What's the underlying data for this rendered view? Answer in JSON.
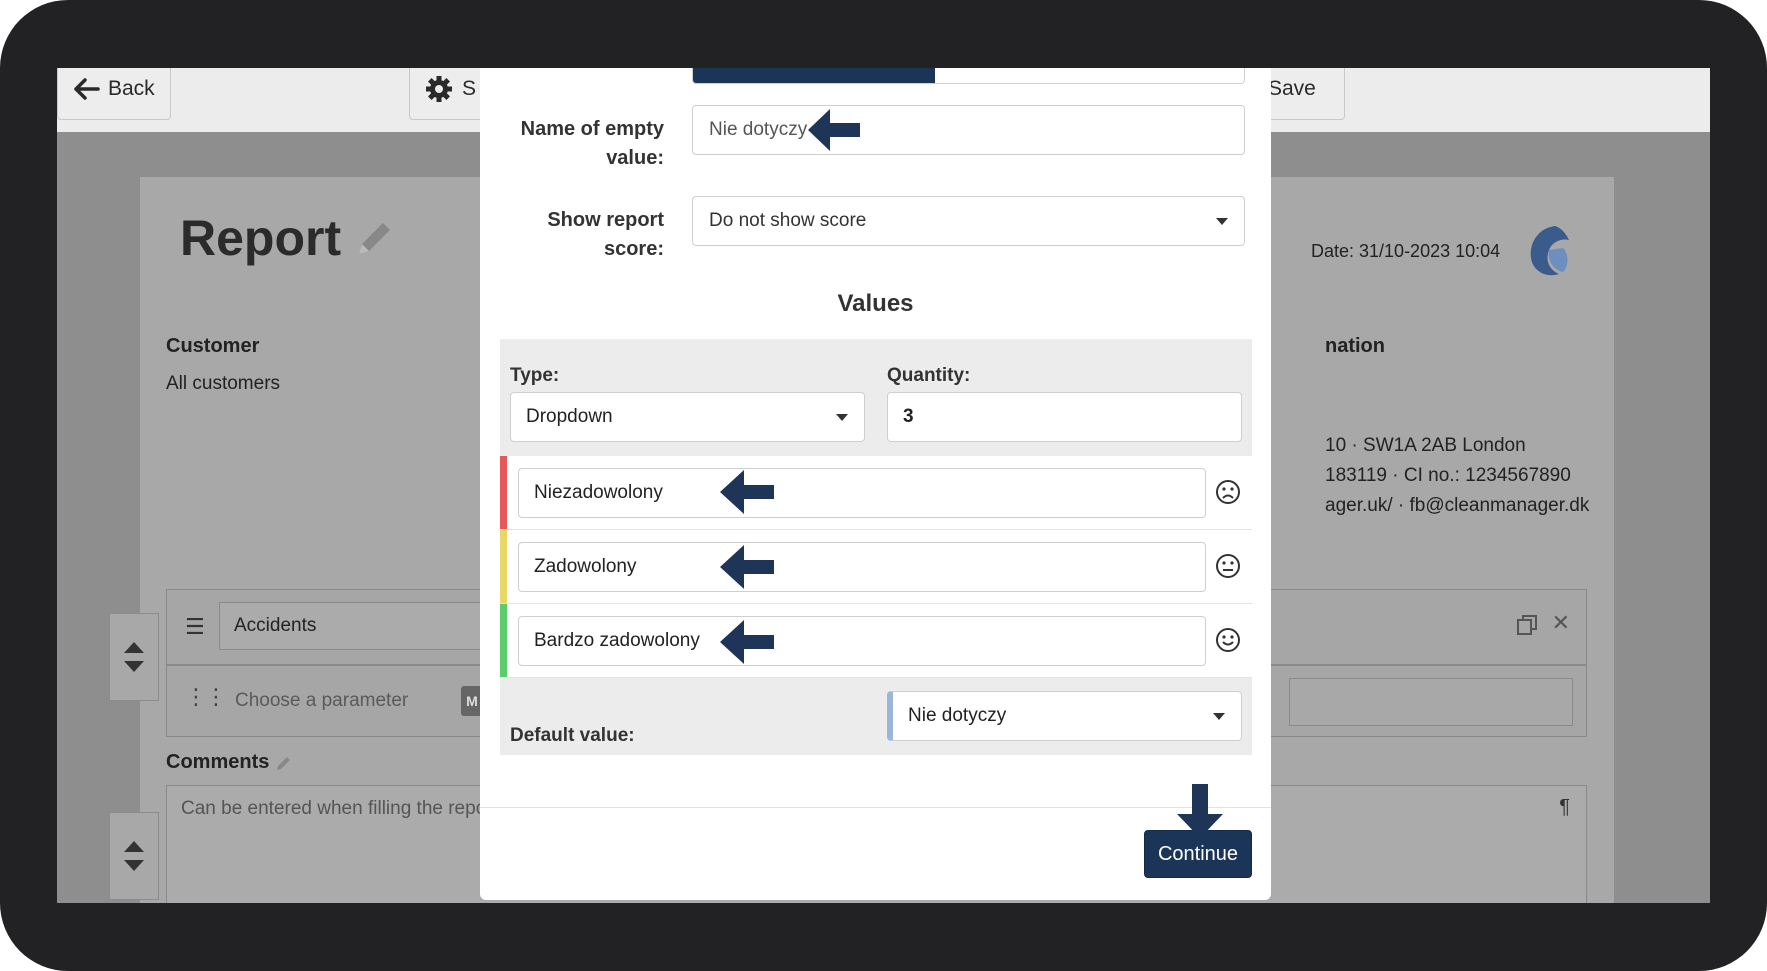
{
  "background": {
    "toolbar": {
      "back_label": "Back",
      "settings_label": "S",
      "save_label": "Save"
    },
    "report": {
      "title": "Report",
      "date": "Date: 31/10-2023 10:04",
      "customer_label": "Customer",
      "customer_value": "All customers",
      "info_label": "nation",
      "info_lines": [
        "10 · SW1A 2AB London",
        "183119 · CI no.: 1234567890",
        "ager.uk/ · fb@cleanmanager.dk"
      ],
      "section_name": "Accidents",
      "parameter_placeholder": "Choose a parameter",
      "parameter_badge": "M",
      "comments_label": "Comments",
      "comments_placeholder": "Can be entered when filling the repo"
    }
  },
  "modal": {
    "empty_value_label_line1": "Name of empty",
    "empty_value_label_line2": "value:",
    "empty_value": "Nie dotyczy",
    "score_label_line1": "Show report",
    "score_label_line2": "score:",
    "score_value": "Do not show score",
    "values_title": "Values",
    "type_label": "Type:",
    "type_value": "Dropdown",
    "quantity_label": "Quantity:",
    "quantity_value": "3",
    "options": [
      {
        "label": "Niezadowolony",
        "color": "#e8575a",
        "face": "sad-face-icon"
      },
      {
        "label": "Zadowolony",
        "color": "#e9d765",
        "face": "neutral-face-icon"
      },
      {
        "label": "Bardzo zadowolony",
        "color": "#5ccd6c",
        "face": "happy-face-icon"
      }
    ],
    "default_label": "Default value:",
    "default_value": "Nie dotyczy",
    "continue_label": "Continue"
  },
  "colors": {
    "primary": "#1b3558",
    "arrow": "#1e3557"
  }
}
